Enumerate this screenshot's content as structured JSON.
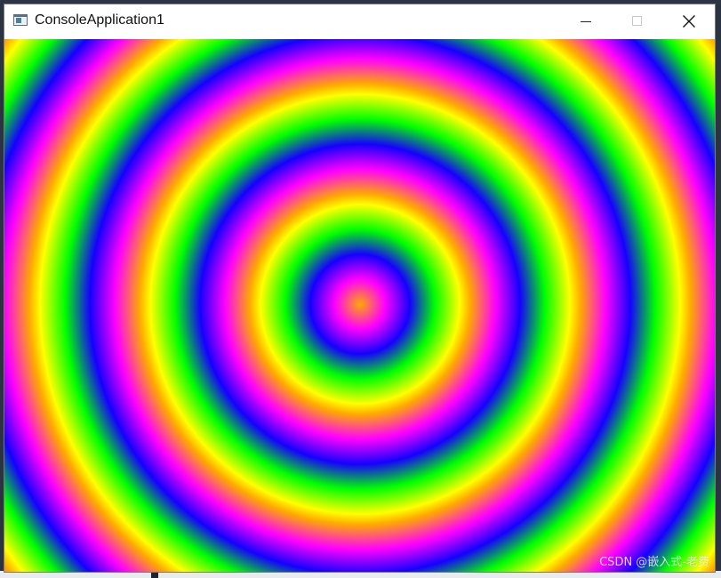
{
  "window": {
    "title": "ConsoleApplication1",
    "app_icon": "console-window-icon",
    "buttons": {
      "minimize_icon": "minimize-icon",
      "maximize_icon": "maximize-icon",
      "close_icon": "close-icon"
    }
  },
  "canvas": {
    "pattern": "concentric-rings",
    "ring_colors": [
      "#ffaa00",
      "#ff00ff",
      "#1500ff",
      "#00ff00",
      "#ffff00"
    ]
  },
  "watermark": {
    "text": "CSDN @嵌入式-老费"
  }
}
